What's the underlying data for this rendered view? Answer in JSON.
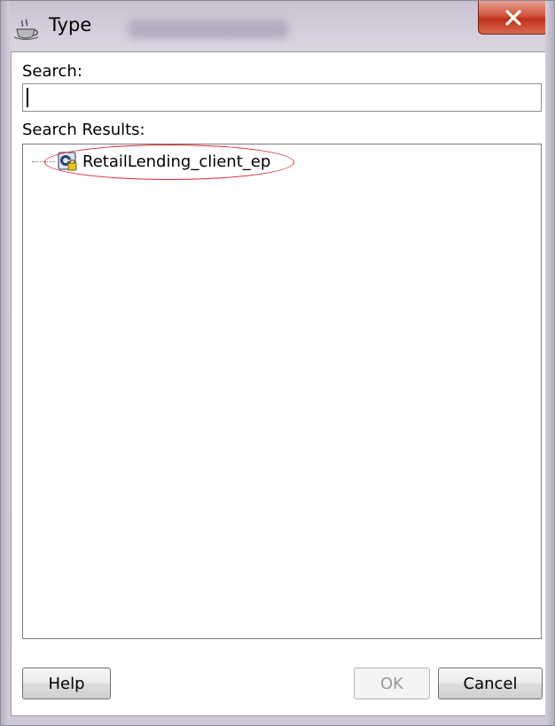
{
  "window": {
    "title": "Type"
  },
  "search": {
    "label": "Search:",
    "value": "",
    "placeholder": ""
  },
  "results": {
    "label": "Search Results:",
    "items": [
      {
        "label": "RetailLending_client_ep"
      }
    ]
  },
  "buttons": {
    "help": "Help",
    "ok": "OK",
    "cancel": "Cancel"
  },
  "icons": {
    "title": "coffee-cup-icon",
    "close": "close-icon",
    "node": "service-endpoint-icon"
  },
  "colors": {
    "highlight": "#e0262f",
    "close_button": "#c0301a"
  }
}
